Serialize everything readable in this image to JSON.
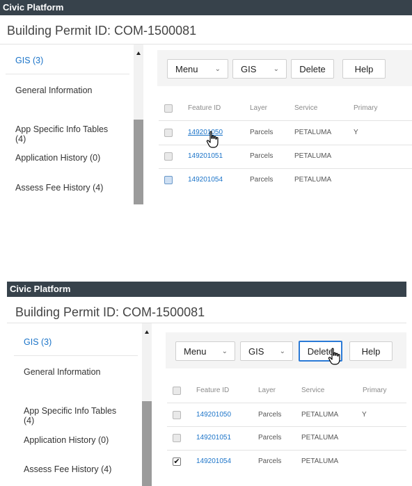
{
  "app": {
    "title": "Civic Platform"
  },
  "page": {
    "title": "Building Permit ID: COM-1500081"
  },
  "sidebar": {
    "items": [
      {
        "label": "GIS (3)"
      },
      {
        "label": "General Information"
      },
      {
        "label": "App Specific Info Tables\n(4)"
      },
      {
        "label": "Application History (0)"
      },
      {
        "label": "Assess Fee History (4)"
      }
    ]
  },
  "toolbar": {
    "menu_label": "Menu",
    "gis_label": "GIS",
    "delete_label": "Delete",
    "help_label": "Help",
    "chevron": "⌄"
  },
  "table": {
    "columns": [
      "Feature ID",
      "Layer",
      "Service",
      "Primary"
    ],
    "rows": [
      {
        "feature_id": "149201050",
        "layer": "Parcels",
        "service": "PETALUMA",
        "primary": "Y"
      },
      {
        "feature_id": "149201051",
        "layer": "Parcels",
        "service": "PETALUMA",
        "primary": ""
      },
      {
        "feature_id": "149201054",
        "layer": "Parcels",
        "service": "PETALUMA",
        "primary": ""
      }
    ]
  },
  "state": {
    "checkmark": "✔"
  },
  "colors": {
    "topbar": "#37424b",
    "link": "#1a73c8",
    "focus_border": "#2b7ad6"
  }
}
